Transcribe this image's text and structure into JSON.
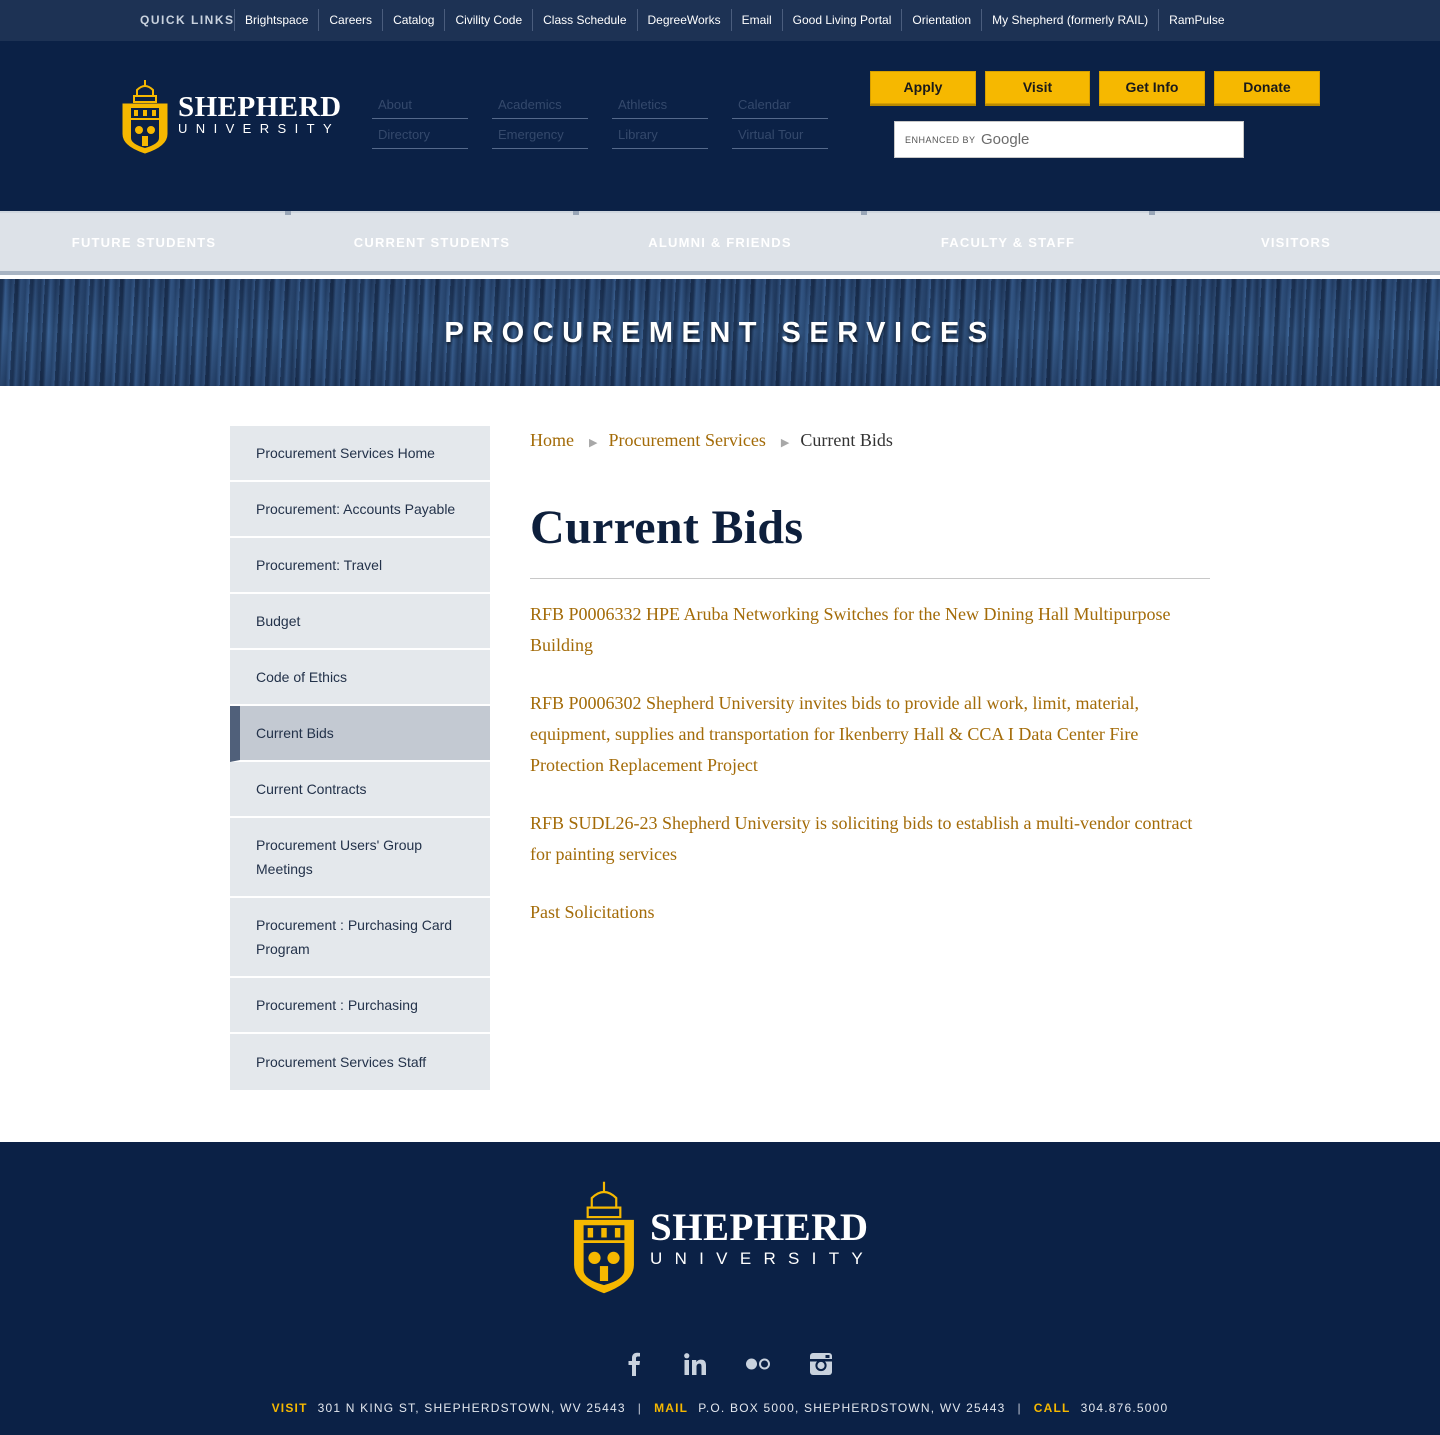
{
  "quick_links": {
    "title": "QUICK LINKS",
    "items": [
      "Brightspace",
      "Careers",
      "Catalog",
      "Civility Code",
      "Class Schedule",
      "DegreeWorks",
      "Email",
      "Good Living Portal",
      "Orientation",
      "My Shepherd (formerly RAIL)",
      "RamPulse"
    ]
  },
  "brand": {
    "name_line1": "SHEPHERD",
    "name_line2": "UNIVERSITY",
    "color_navy": "#0b2146",
    "color_gold": "#f6b800"
  },
  "header_nav": [
    "About",
    "Academics",
    "Athletics",
    "Calendar",
    "Directory",
    "Emergency",
    "Library",
    "Virtual Tour"
  ],
  "cta_buttons": [
    "Apply",
    "Visit",
    "Get Info",
    "Donate"
  ],
  "search": {
    "enhanced_label": "ENHANCED BY",
    "provider": "Google"
  },
  "main_nav": [
    "FUTURE STUDENTS",
    "CURRENT STUDENTS",
    "ALUMNI & FRIENDS",
    "FACULTY & STAFF",
    "VISITORS"
  ],
  "banner": {
    "title": "PROCUREMENT SERVICES"
  },
  "sidebar": {
    "active_index": 5,
    "items": [
      "Procurement Services Home",
      "Procurement: Accounts Payable",
      "Procurement: Travel",
      "Budget",
      "Code of Ethics",
      "Current Bids",
      "Current Contracts",
      "Procurement Users' Group Meetings",
      "Procurement : Purchasing Card Program",
      "Procurement : Purchasing",
      "Procurement Services Staff"
    ]
  },
  "breadcrumb": {
    "items": [
      "Home",
      "Procurement Services"
    ],
    "separator": "▶",
    "current": "Current Bids"
  },
  "content": {
    "title": "Current Bids",
    "links": [
      "RFB P0006332 HPE Aruba Networking Switches for the New Dining Hall Multipurpose Building",
      "RFB P0006302 Shepherd University invites bids to provide all work, limit, material, equipment, supplies and transportation for Ikenberry Hall & CCA I Data Center Fire Protection Replacement Project",
      "RFB SUDL26-23 Shepherd University is soliciting bids to establish a multi-vendor contract for painting services",
      "Past Solicitations"
    ]
  },
  "footer": {
    "social_icons": [
      "facebook-icon",
      "linkedin-icon",
      "flickr-icon",
      "instagram-icon"
    ],
    "visit_label": "VISIT",
    "visit_value": "301 N KING ST, SHEPHERDSTOWN, WV 25443",
    "mail_label": "MAIL",
    "mail_value": "P.O. BOX 5000, SHEPHERDSTOWN, WV 25443",
    "call_label": "CALL",
    "call_value": "304.876.5000",
    "pipe": "|"
  }
}
